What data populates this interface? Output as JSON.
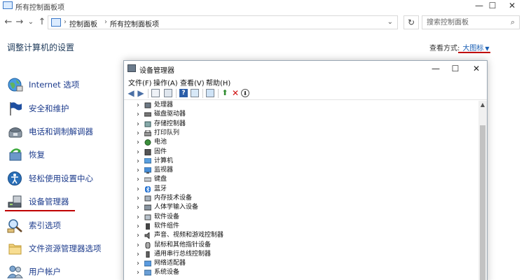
{
  "control_panel": {
    "window_title": "所有控制面板项",
    "window_controls": {
      "minimize": "—",
      "maximize": "☐",
      "close": "✕"
    },
    "nav": {
      "back": "←",
      "forward": "→",
      "recent": "⌄",
      "up": "↑"
    },
    "breadcrumb": [
      "控制面板",
      "所有控制面板项"
    ],
    "breadcrumb_separator": "›",
    "address_dropdown": "⌄",
    "refresh": "↻",
    "search_placeholder": "搜索控制面板",
    "search_icon": "⌕",
    "heading": "调整计算机的设置",
    "view_by_label": "查看方式:",
    "view_by_value": "大图标",
    "view_by_arrow": "▼",
    "items": [
      {
        "label": "Internet 选项",
        "icon": "globe-icon"
      },
      {
        "label": "安全和维护",
        "icon": "flag-icon"
      },
      {
        "label": "电话和调制解调器",
        "icon": "phone-icon"
      },
      {
        "label": "恢复",
        "icon": "recovery-icon"
      },
      {
        "label": "轻松使用设置中心",
        "icon": "ease-of-access-icon"
      },
      {
        "label": "设备管理器",
        "icon": "device-manager-icon"
      },
      {
        "label": "索引选项",
        "icon": "indexing-icon"
      },
      {
        "label": "文件资源管理器选项",
        "icon": "folder-icon"
      },
      {
        "label": "用户帐户",
        "icon": "users-icon"
      }
    ],
    "highlight_color": "#c00000",
    "link_color": "#1c3b8c"
  },
  "device_manager": {
    "title": "设备管理器",
    "window_controls": {
      "minimize": "—",
      "maximize": "☐",
      "close": "✕"
    },
    "menu": [
      "文件(F)",
      "操作(A)",
      "查看(V)",
      "帮助(H)"
    ],
    "toolbar_icons": [
      "back-icon",
      "forward-icon",
      "properties-icon",
      "view-icon",
      "help-icon",
      "monitor-icon",
      "update-driver-icon",
      "uninstall-icon",
      "download-icon"
    ],
    "expand_glyph": "›",
    "devices": [
      {
        "label": "处理器",
        "icon": "processor-icon"
      },
      {
        "label": "磁盘驱动器",
        "icon": "disk-icon"
      },
      {
        "label": "存储控制器",
        "icon": "storage-controller-icon"
      },
      {
        "label": "打印队列",
        "icon": "printer-icon"
      },
      {
        "label": "电池",
        "icon": "battery-icon"
      },
      {
        "label": "固件",
        "icon": "firmware-icon"
      },
      {
        "label": "计算机",
        "icon": "computer-icon"
      },
      {
        "label": "监视器",
        "icon": "monitor-icon"
      },
      {
        "label": "键盘",
        "icon": "keyboard-icon"
      },
      {
        "label": "蓝牙",
        "icon": "bluetooth-icon"
      },
      {
        "label": "内存技术设备",
        "icon": "memory-icon"
      },
      {
        "label": "人体学输入设备",
        "icon": "hid-icon"
      },
      {
        "label": "软件设备",
        "icon": "software-device-icon"
      },
      {
        "label": "软件组件",
        "icon": "software-component-icon"
      },
      {
        "label": "声音、视频和游戏控制器",
        "icon": "sound-icon"
      },
      {
        "label": "鼠标和其他指针设备",
        "icon": "mouse-icon"
      },
      {
        "label": "通用串行总线控制器",
        "icon": "usb-icon"
      },
      {
        "label": "网络适配器",
        "icon": "network-adapter-icon"
      },
      {
        "label": "系统设备",
        "icon": "system-device-icon"
      }
    ]
  }
}
